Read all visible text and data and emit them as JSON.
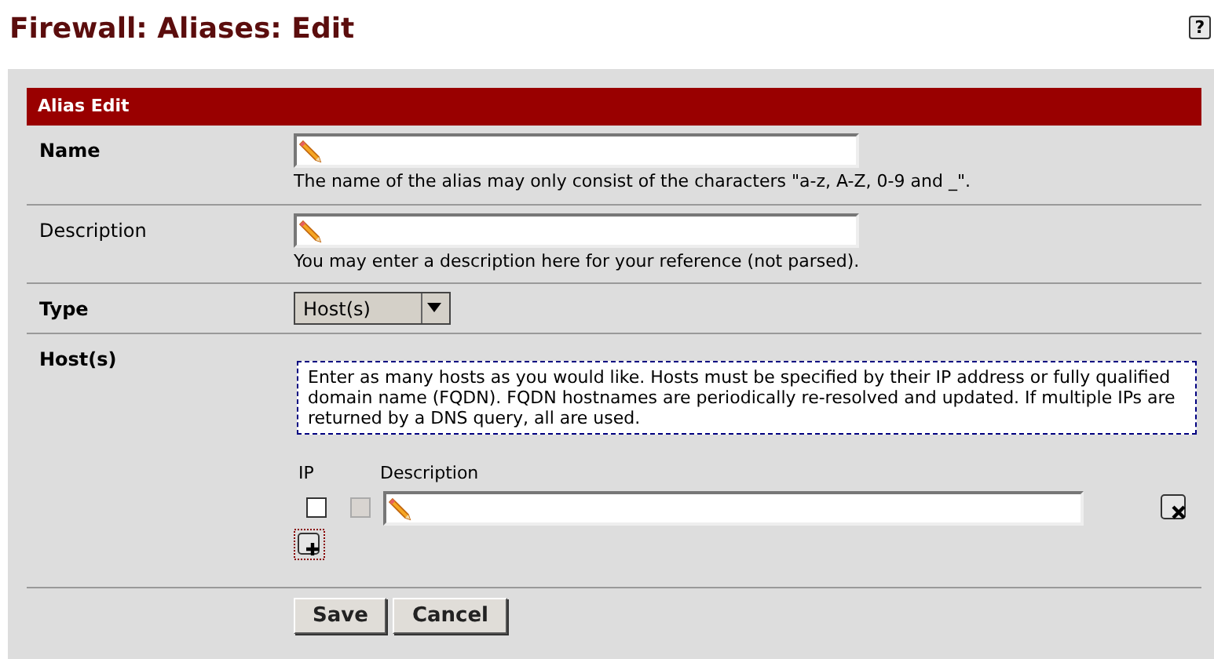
{
  "page_title": "Firewall: Aliases: Edit",
  "help_button": "?",
  "section": {
    "title": "Alias Edit"
  },
  "fields": [
    {
      "kind": "text",
      "label": "Name",
      "label_bold": true,
      "hint": "The name of the alias may only consist of the characters \"a-z, A-Z, 0-9 and _\"."
    },
    {
      "kind": "text",
      "label": "Description",
      "label_bold": false,
      "hint": "You may enter a description here for your reference (not parsed)."
    },
    {
      "kind": "select",
      "label": "Type",
      "label_bold": true,
      "value": "Host(s)"
    }
  ],
  "hosts": {
    "label": "Host(s)",
    "info": "Enter as many hosts as you would like. Hosts must be specified by their IP address or fully qualified domain name (FQDN). FQDN hostnames are periodically re-resolved and updated. If multiple IPs are returned by a DNS query, all are used.",
    "columns": [
      "IP",
      "Description"
    ],
    "rows": [
      {
        "subnet_disabled": true
      }
    ]
  },
  "buttons": [
    "Save",
    "Cancel"
  ]
}
